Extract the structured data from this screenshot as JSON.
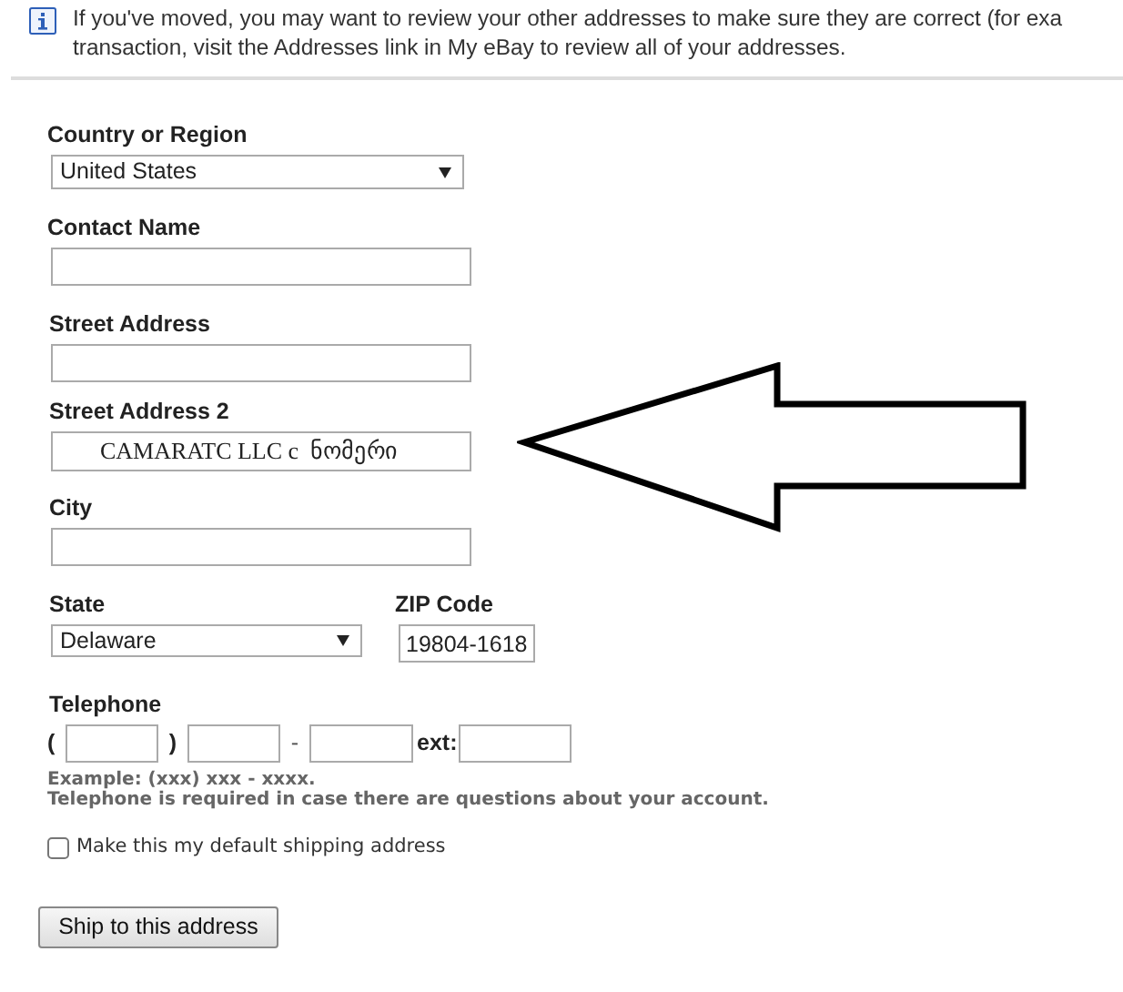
{
  "notice": {
    "lines": [
      "If you've moved, you may want to review your other addresses to make sure they are correct (for exa",
      "transaction, visit the Addresses link in My eBay to review all of your addresses."
    ]
  },
  "form": {
    "country": {
      "label": "Country or Region",
      "value": "United States"
    },
    "contact_name": {
      "label": "Contact Name"
    },
    "street_address": {
      "label": "Street Address"
    },
    "street_address_2": {
      "label": "Street Address 2",
      "value": "CAMARATC LLC c  ნომერი"
    },
    "city": {
      "label": "City"
    },
    "state": {
      "label": "State",
      "value": "Delaware"
    },
    "zip": {
      "label": "ZIP Code",
      "value": "19804-1618"
    },
    "telephone": {
      "label": "Telephone",
      "open_paren": "(",
      "close_paren": ")",
      "dash": "-",
      "ext_label": "ext:"
    },
    "example": "Example: (xxx) xxx - xxxx.",
    "requirement": "Telephone is required in case there are questions about your account.",
    "default_shipping": {
      "label": "Make this my default shipping address",
      "checked": false
    },
    "submit": "Ship to this address"
  }
}
